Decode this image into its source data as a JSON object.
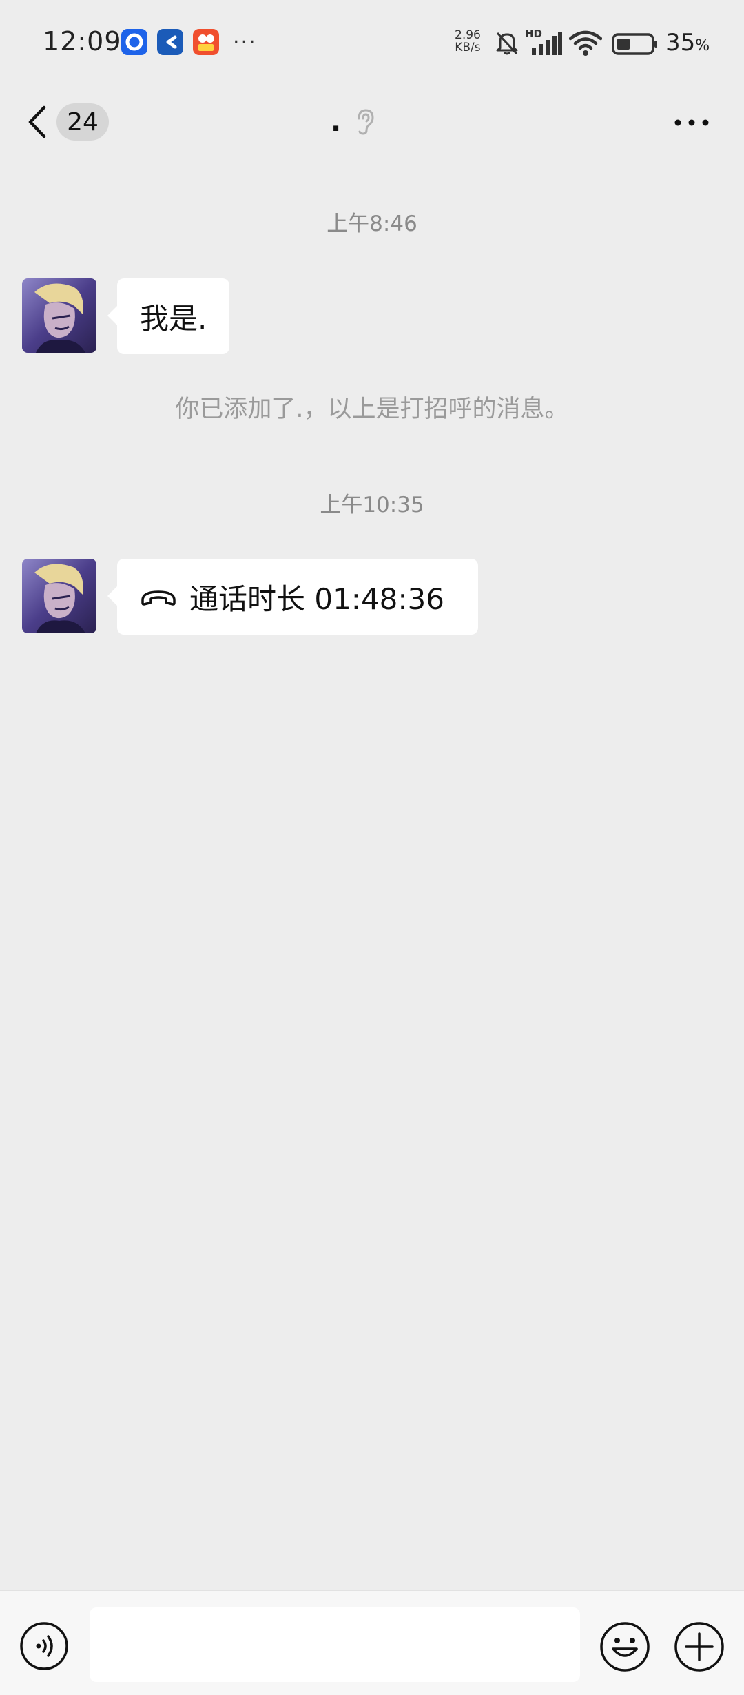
{
  "status_bar": {
    "time": "12:09",
    "notification_icons": [
      "app-blue-circle-icon",
      "app-blue-c-icon",
      "app-orange-video-icon"
    ],
    "more": "···",
    "net_speed_value": "2.96",
    "net_speed_unit": "KB/s",
    "signal_label": "HD",
    "battery_percent": "35",
    "battery_unit": "%"
  },
  "header": {
    "unread_count": "24",
    "title": ".",
    "title_icon": "ear-icon",
    "back_icon": "chevron-left-icon",
    "more_icon": "more-horizontal-icon"
  },
  "messages": [
    {
      "type": "timestamp",
      "text": "上午8:46"
    },
    {
      "type": "text",
      "from": "contact",
      "text": "我是."
    },
    {
      "type": "system",
      "text": "你已添加了.，以上是打招呼的消息。"
    },
    {
      "type": "timestamp",
      "text": "上午10:35"
    },
    {
      "type": "call",
      "from": "contact",
      "icon": "phone-hangup-icon",
      "text": "通话时长 01:48:36"
    }
  ],
  "input_bar": {
    "placeholder": "",
    "voice_icon": "voice-icon",
    "emoji_icon": "emoji-icon",
    "plus_icon": "plus-circle-icon"
  },
  "colors": {
    "background": "#EDEDED",
    "bubble": "#FFFFFF",
    "timestamp_text": "#8A8A8A"
  }
}
